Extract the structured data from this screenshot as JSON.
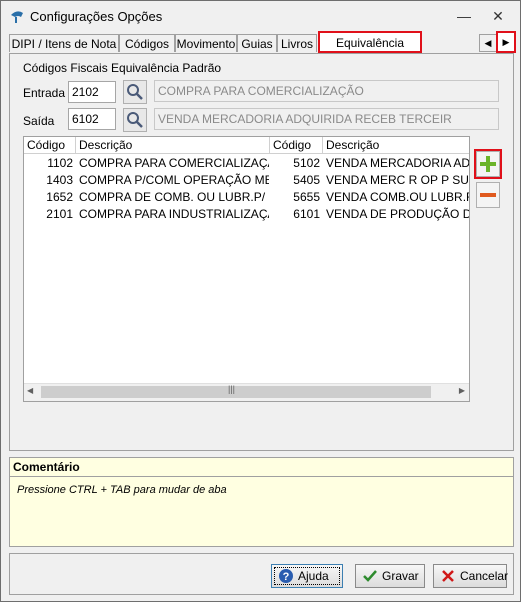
{
  "window": {
    "title": "Configurações Opções",
    "minimize": "—",
    "close": "✕"
  },
  "tabs": [
    {
      "label": "DIPI / Itens de Nota"
    },
    {
      "label": "Códigos"
    },
    {
      "label": "Movimento"
    },
    {
      "label": "Guias"
    },
    {
      "label": "Livros"
    },
    {
      "label": "Equivalência CFOP",
      "active": true
    }
  ],
  "tab_arrows": {
    "left": "◀",
    "right": "▶"
  },
  "panel": {
    "section_title": "Códigos Fiscais Equivalência Padrão",
    "entrada": {
      "label": "Entrada",
      "code": "2102",
      "description": "COMPRA PARA COMERCIALIZAÇÃO"
    },
    "saida": {
      "label": "Saída",
      "code": "6102",
      "description": "VENDA MERCADORIA ADQUIRIDA RECEB TERCEIR"
    }
  },
  "grid": {
    "headers": [
      "Código",
      "Descrição",
      "Código",
      "Descrição"
    ],
    "rows": [
      [
        "1102",
        "COMPRA PARA COMERCIALIZAÇÃO",
        "5102",
        "VENDA MERCADORIA ADQUI"
      ],
      [
        "1403",
        "COMPRA P/COML OPERAÇÃO MERC S",
        "5405",
        "VENDA MERC R OP P SUJ REC"
      ],
      [
        "1652",
        "COMPRA DE COMB. OU LUBR.P/ CON",
        "5655",
        "VENDA COMB.OU LUBR.RECE"
      ],
      [
        "2101",
        "COMPRA PARA INDUSTRIALIZAÇÃO",
        "6101",
        "VENDA DE PRODUÇÃO DO E"
      ]
    ],
    "scroll_left": "◀",
    "scroll_right": "▶",
    "scroll_grip": "|||"
  },
  "comment": {
    "title": "Comentário",
    "text": "Pressione CTRL + TAB para  mudar de aba"
  },
  "buttons": {
    "help": "Ajuda",
    "save": "Gravar",
    "cancel": "Cancelar"
  },
  "colors": {
    "highlight": "#e0101a",
    "add": "#6bb42a",
    "remove": "#e05a1e",
    "comment_bg": "#ffffe1"
  }
}
